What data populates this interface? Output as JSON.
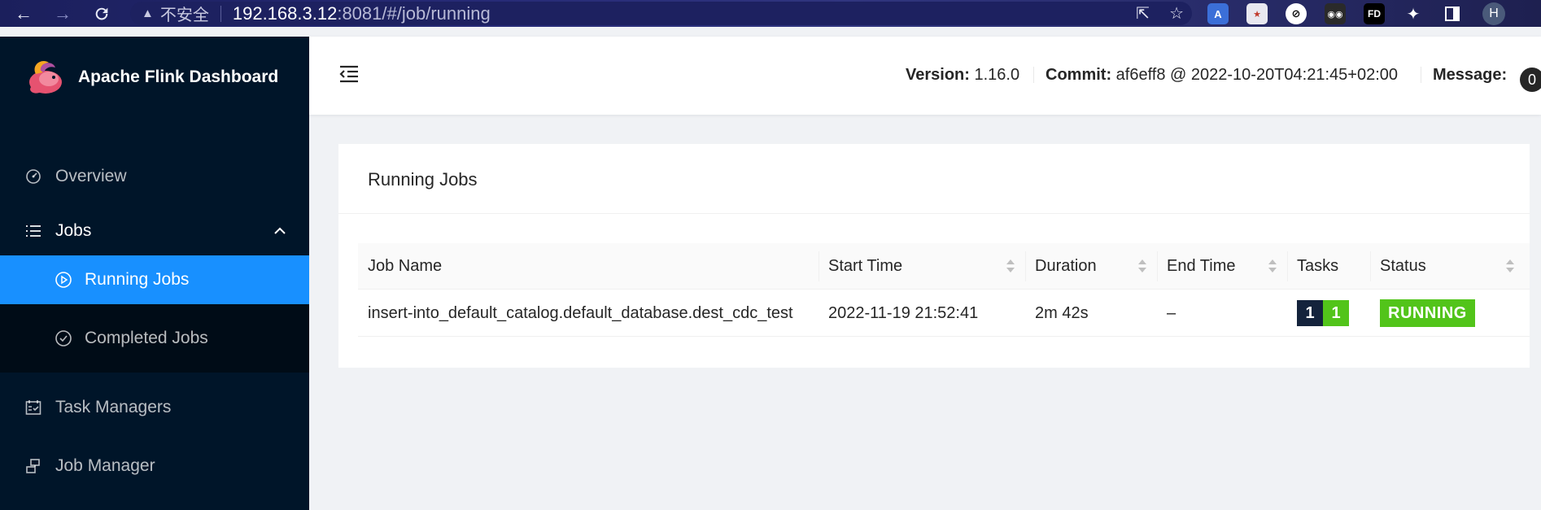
{
  "browser": {
    "insecure_label": "不安全",
    "url_host": "192.168.3.12",
    "url_path": ":8081/#/job/running",
    "profile_initial": "H"
  },
  "sidebar": {
    "brand_title": "Apache Flink Dashboard",
    "items": [
      {
        "label": "Overview",
        "icon": "dashboard-icon"
      },
      {
        "label": "Jobs",
        "icon": "list-icon"
      },
      {
        "label": "Task Managers",
        "icon": "schedule-icon"
      },
      {
        "label": "Job Manager",
        "icon": "cluster-icon"
      }
    ],
    "jobs_sub": [
      {
        "label": "Running Jobs",
        "icon": "play-circle-icon",
        "active": true
      },
      {
        "label": "Completed Jobs",
        "icon": "check-circle-icon",
        "active": false
      }
    ]
  },
  "header": {
    "version_label": "Version:",
    "version_value": "1.16.0",
    "commit_label": "Commit:",
    "commit_value": "af6eff8 @ 2022-10-20T04:21:45+02:00",
    "message_label": "Message:",
    "message_count": "0"
  },
  "card": {
    "title": "Running Jobs",
    "columns": [
      "Job Name",
      "Start Time",
      "Duration",
      "End Time",
      "Tasks",
      "Status"
    ],
    "rows": [
      {
        "job_name": "insert-into_default_catalog.default_database.dest_cdc_test",
        "start_time": "2022-11-19 21:52:41",
        "duration": "2m 42s",
        "end_time": "–",
        "tasks": [
          "1",
          "1"
        ],
        "status": "RUNNING"
      }
    ]
  },
  "colors": {
    "sidebar_bg": "#001529",
    "submenu_bg": "#000c17",
    "active": "#1890ff",
    "running": "#52c41a",
    "task_total": "#14233c",
    "task_running": "#52c41a"
  }
}
